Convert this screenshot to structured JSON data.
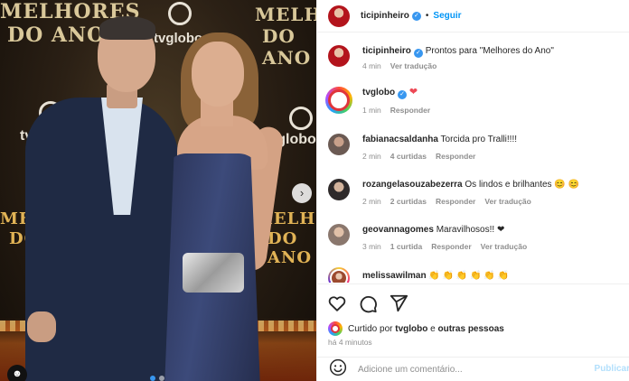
{
  "photo": {
    "backdrop_texts": [
      "MELHORES",
      "DO ANO",
      "tvglobo",
      "MELHORES",
      "DO ANO",
      "tvglobo",
      "tvglobo",
      "MELHORES",
      "DO ANO",
      "MELHORES",
      "DO ANO"
    ],
    "next_arrow": "›",
    "tag_icon": "person-icon",
    "carousel": {
      "count": 2,
      "active": 1
    }
  },
  "post": {
    "author": "ticipinheiro",
    "separator": "•",
    "follow_label": "Seguir"
  },
  "comments": [
    {
      "user": "ticipinheiro",
      "verified": true,
      "text": "Prontos para \"Melhores do Ano\"",
      "time": "4 min",
      "likes": "",
      "reply": "",
      "translate": "Ver tradução",
      "avatar": "av-tici"
    },
    {
      "user": "tvglobo",
      "verified": true,
      "text": "❤",
      "time": "1 min",
      "likes": "",
      "reply": "Responder",
      "translate": "",
      "avatar": "av-glob"
    },
    {
      "user": "fabianacsaldanha",
      "verified": false,
      "text": "Torcida pro Tralli!!!!",
      "time": "2 min",
      "likes": "4 curtidas",
      "reply": "Responder",
      "translate": "",
      "avatar": "av-gray"
    },
    {
      "user": "rozangelasouzabezerra",
      "verified": false,
      "text": "Os lindos e brilhantes 😊 😊",
      "time": "2 min",
      "likes": "2 curtidas",
      "reply": "Responder",
      "translate": "Ver tradução",
      "avatar": "av-dark"
    },
    {
      "user": "geovannagomes",
      "verified": false,
      "text": "Maravilhosos!! ❤",
      "time": "3 min",
      "likes": "1 curtida",
      "reply": "Responder",
      "translate": "Ver tradução",
      "avatar": "av-light"
    },
    {
      "user": "melissawilman",
      "verified": false,
      "text": "👏 👏 👏 👏 👏 👏",
      "time": "",
      "likes": "",
      "reply": "",
      "translate": "",
      "avatar": "av-story"
    }
  ],
  "actions": {
    "like_icon": "heart-icon",
    "comment_icon": "comment-icon",
    "share_icon": "share-icon"
  },
  "liked_by": {
    "prefix": "Curtido por",
    "user": "tvglobo",
    "conj": "e",
    "others": "outras pessoas"
  },
  "posted_ago": "há 4 minutos",
  "add_comment": {
    "placeholder": "Adicione um comentário...",
    "publish": "Publicar",
    "emoji_icon": "smiley-icon"
  }
}
